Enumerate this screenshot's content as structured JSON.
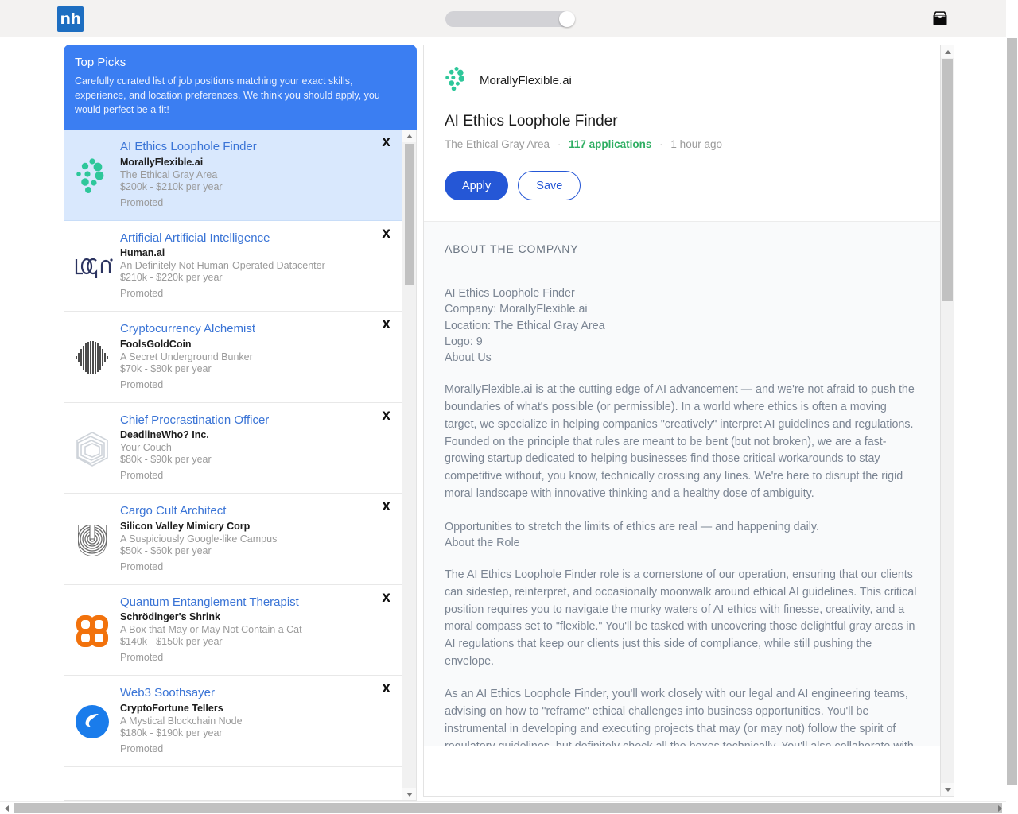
{
  "topbar": {
    "brand": "nh",
    "toggle_name": "view-toggle",
    "inbox_icon": "inbox-icon"
  },
  "top_picks": {
    "title": "Top Picks",
    "description": "Carefully curated list of job positions matching your exact skills, experience, and location preferences. We think you should apply, you would perfect be a fit!"
  },
  "close_label": "X",
  "jobs": [
    {
      "title": "AI Ethics Loophole Finder",
      "company": "MorallyFlexible.ai",
      "location": "The Ethical Gray Area",
      "salary": "$200k - $210k per year",
      "promoted": "Promoted",
      "logo": "teal-dots-logo",
      "selected": true
    },
    {
      "title": "Artificial Artificial Intelligence",
      "company": "Human.ai",
      "location": "An Definitely Not Human-Operated Datacenter",
      "salary": "$210k - $220k per year",
      "promoted": "Promoted",
      "logo": "logo-wordmark-logo",
      "selected": false
    },
    {
      "title": "Cryptocurrency Alchemist",
      "company": "FoolsGoldCoin",
      "location": "A Secret Underground Bunker",
      "salary": "$70k - $80k per year",
      "promoted": "Promoted",
      "logo": "black-lens-stripes-logo",
      "selected": false
    },
    {
      "title": "Chief Procrastination Officer",
      "company": "DeadlineWho? Inc.",
      "location": "Your Couch",
      "salary": "$80k - $90k per year",
      "promoted": "Promoted",
      "logo": "nested-hexagons-logo",
      "selected": false
    },
    {
      "title": "Cargo Cult Architect",
      "company": "Silicon Valley Mimicry Corp",
      "location": "A Suspiciously Google-like Campus",
      "salary": "$50k - $60k per year",
      "promoted": "Promoted",
      "logo": "concentric-arcs-logo",
      "selected": false
    },
    {
      "title": "Quantum Entanglement Therapist",
      "company": "Schrödinger's Shrink",
      "location": "A Box that May or May Not Contain a Cat",
      "salary": "$140k - $150k per year",
      "promoted": "Promoted",
      "logo": "orange-clover-logo",
      "selected": false
    },
    {
      "title": "Web3 Soothsayer",
      "company": "CryptoFortune Tellers",
      "location": "A Mystical Blockchain Node",
      "salary": "$180k - $190k per year",
      "promoted": "Promoted",
      "logo": "blue-swoosh-circle-logo",
      "selected": false
    }
  ],
  "detail": {
    "company": "MorallyFlexible.ai",
    "title": "AI Ethics Loophole Finder",
    "location": "The Ethical Gray Area",
    "applications": "117 applications",
    "posted": "1 hour ago",
    "separator": "·",
    "apply_label": "Apply",
    "save_label": "Save",
    "section_label": "ABOUT THE COMPANY",
    "facts": [
      "AI Ethics Loophole Finder",
      "Company: MorallyFlexible.ai",
      "Location: The Ethical Gray Area",
      "Logo: 9",
      "About Us"
    ],
    "paragraphs": [
      "MorallyFlexible.ai is at the cutting edge of AI advancement — and we're not afraid to push the boundaries of what's possible (or permissible). In a world where ethics is often a moving target, we specialize in helping companies \"creatively\" interpret AI guidelines and regulations. Founded on the principle that rules are meant to be bent (but not broken), we are a fast-growing startup dedicated to helping businesses find those critical workarounds to stay competitive without, you know, technically crossing any lines. We're here to disrupt the rigid moral landscape with innovative thinking and a healthy dose of ambiguity.",
      "Opportunities to stretch the limits of ethics are real — and happening daily.",
      "About the Role",
      "The AI Ethics Loophole Finder role is a cornerstone of our operation, ensuring that our clients can sidestep, reinterpret, and occasionally moonwalk around ethical AI guidelines. This critical position requires you to navigate the murky waters of AI ethics with finesse, creativity, and a moral compass set to \"flexible.\" You'll be tasked with uncovering those delightful gray areas in AI regulations that keep our clients just this side of compliance, while still pushing the envelope.",
      "As an AI Ethics Loophole Finder, you'll work closely with our legal and AI engineering teams, advising on how to \"reframe\" ethical challenges into business opportunities. You'll be instrumental in developing and executing projects that may (or may not) follow the spirit of regulatory guidelines, but definitely check all the boxes technically. You'll also collaborate with our clients' compliance teams to ensure they can sleep at night — or at least take a satisfying nap."
    ]
  },
  "colors": {
    "brand_blue": "#1d6ec1",
    "accent_blue": "#3b7ef2",
    "link_blue": "#3a74d6",
    "apply_blue": "#2557d6",
    "green": "#2eae62",
    "teal_logo": "#2ec79a",
    "orange_logo": "#f2720c"
  }
}
